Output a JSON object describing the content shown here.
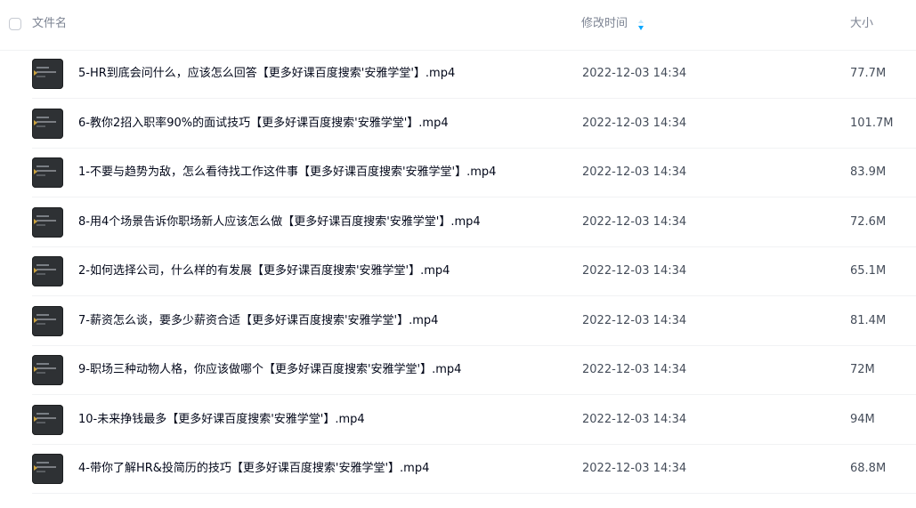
{
  "header": {
    "name_label": "文件名",
    "time_label": "修改时间",
    "size_label": "大小",
    "sort_icon": "sort-icon",
    "sort_color": "#06a7ff"
  },
  "files": [
    {
      "name": "5-HR到底会问什么，应该怎么回答【更多好课百度搜索'安雅学堂'】.mp4",
      "time": "2022-12-03 14:34",
      "size": "77.7M"
    },
    {
      "name": "6-教你2招入职率90%的面试技巧【更多好课百度搜索'安雅学堂'】.mp4",
      "time": "2022-12-03 14:34",
      "size": "101.7M"
    },
    {
      "name": "1-不要与趋势为敌，怎么看待找工作这件事【更多好课百度搜索'安雅学堂'】.mp4",
      "time": "2022-12-03 14:34",
      "size": "83.9M"
    },
    {
      "name": "8-用4个场景告诉你职场新人应该怎么做【更多好课百度搜索'安雅学堂'】.mp4",
      "time": "2022-12-03 14:34",
      "size": "72.6M"
    },
    {
      "name": "2-如何选择公司，什么样的有发展【更多好课百度搜索'安雅学堂'】.mp4",
      "time": "2022-12-03 14:34",
      "size": "65.1M"
    },
    {
      "name": "7-薪资怎么谈，要多少薪资合适【更多好课百度搜索'安雅学堂'】.mp4",
      "time": "2022-12-03 14:34",
      "size": "81.4M"
    },
    {
      "name": "9-职场三种动物人格，你应该做哪个【更多好课百度搜索'安雅学堂'】.mp4",
      "time": "2022-12-03 14:34",
      "size": "72M"
    },
    {
      "name": "10-未来挣钱最多【更多好课百度搜索'安雅学堂'】.mp4",
      "time": "2022-12-03 14:34",
      "size": "94M"
    },
    {
      "name": "4-带你了解HR&投简历的技巧【更多好课百度搜索'安雅学堂'】.mp4",
      "time": "2022-12-03 14:34",
      "size": "68.8M"
    }
  ]
}
